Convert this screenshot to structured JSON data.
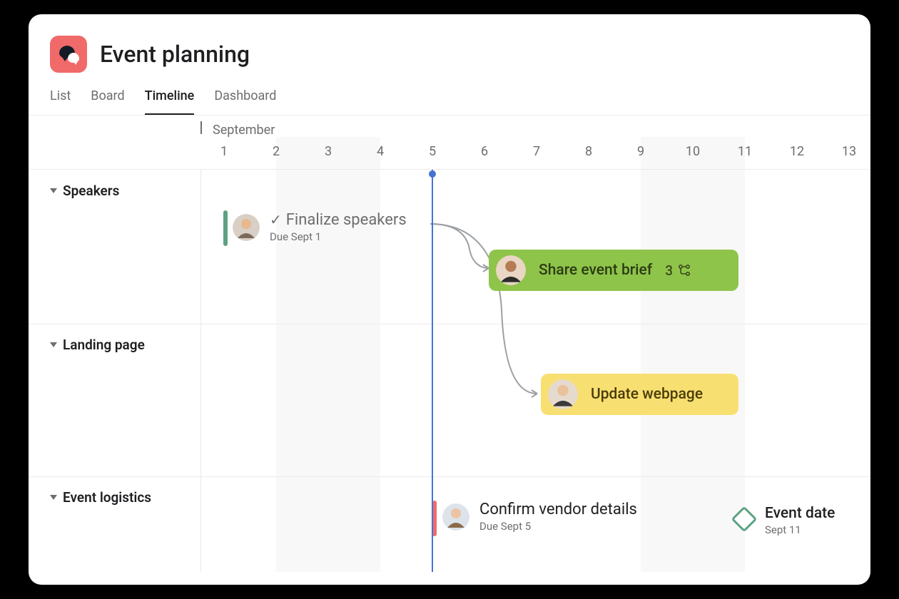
{
  "project": {
    "title": "Event planning"
  },
  "tabs": [
    {
      "label": "List",
      "active": false
    },
    {
      "label": "Board",
      "active": false
    },
    {
      "label": "Timeline",
      "active": true
    },
    {
      "label": "Dashboard",
      "active": false
    }
  ],
  "timeline": {
    "month": "September",
    "dates": [
      "1",
      "2",
      "3",
      "4",
      "5",
      "6",
      "7",
      "8",
      "9",
      "10",
      "11",
      "12",
      "13"
    ],
    "today_index": 4,
    "weekend_ranges": [
      [
        2,
        3
      ],
      [
        9,
        10
      ]
    ]
  },
  "sections": [
    {
      "name": "Speakers"
    },
    {
      "name": "Landing page"
    },
    {
      "name": "Event logistics"
    }
  ],
  "tasks": {
    "finalize_speakers": {
      "title": "Finalize speakers",
      "subtitle": "Due Sept 1",
      "completed": true,
      "pill_color": "#5da283"
    },
    "share_brief": {
      "title": "Share event brief",
      "subtask_count": "3",
      "color": "green"
    },
    "update_webpage": {
      "title": "Update webpage",
      "color": "yellow"
    },
    "confirm_vendor": {
      "title": "Confirm vendor details",
      "subtitle": "Due Sept 5",
      "pill_color": "#f06a6a"
    }
  },
  "milestone": {
    "title": "Event date",
    "subtitle": "Sept 11"
  }
}
